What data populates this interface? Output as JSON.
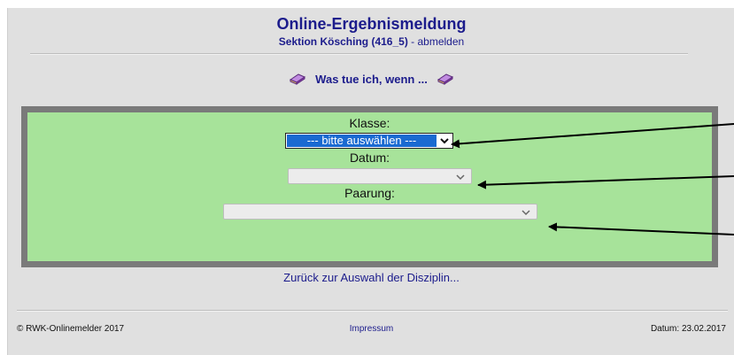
{
  "header": {
    "title": "Online-Ergebnismeldung",
    "subtitle_bold": "Sektion Kösching (416_5)",
    "subtitle_sep": " - ",
    "logout_link": "abmelden"
  },
  "help": {
    "label": "Was tue ich, wenn ...",
    "icon": "book-icon"
  },
  "form": {
    "klasse_label": "Klasse:",
    "klasse_value": "--- bitte auswählen ---",
    "datum_label": "Datum:",
    "datum_value": "",
    "paarung_label": "Paarung:",
    "paarung_value": ""
  },
  "back_link": "Zurück zur Auswahl der Disziplin...",
  "footer": {
    "copyright": "© RWK-Onlinemelder 2017",
    "impressum": "Impressum",
    "date": "Datum: 23.02.2017"
  },
  "colors": {
    "accent": "#1c1c8c",
    "panel": "#a7e39a",
    "panel_border": "#7a7a7a",
    "page_bg": "#e0e0e0"
  }
}
